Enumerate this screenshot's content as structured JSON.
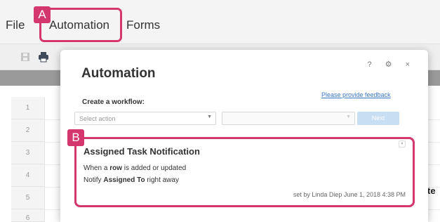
{
  "menu": {
    "file": "File",
    "automation": "Automation",
    "forms": "Forms"
  },
  "callouts": {
    "a": "A",
    "b": "B"
  },
  "row_numbers": [
    "1",
    "2",
    "3",
    "4",
    "5",
    "6"
  ],
  "background_fragment": "te",
  "modal": {
    "title": "Automation",
    "controls": "? ⚙ ×",
    "feedback_link": "Please provide feedback",
    "create_label": "Create a workflow:",
    "select_action_placeholder": "Select action",
    "next_label": "Next"
  },
  "workflow": {
    "title": "Assigned Task Notification",
    "line1_pre": "When a ",
    "line1_bold": "row",
    "line1_post": " is added or updated",
    "line2_pre": "Notify ",
    "line2_bold": "Assigned To",
    "line2_post": " right away",
    "meta": "set by Linda Diep  June 1, 2018 4:38 PM"
  },
  "colors": {
    "callout": "#d4376e",
    "link": "#3a78c3",
    "next_button": "#c8def2"
  }
}
